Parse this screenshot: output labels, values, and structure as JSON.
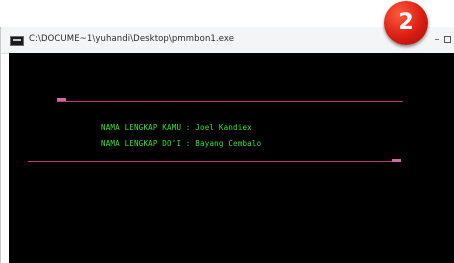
{
  "window": {
    "title": "C:\\DOCUME~1\\yuhandi\\Desktop\\pmmbon1.exe",
    "minimize_glyph": "–",
    "icon": "console-app-icon"
  },
  "console": {
    "lines": [
      "NAMA LENGKAP KAMU : Joel Kandiex",
      "NAMA LENGKAP DO'I : Bayang Cembalo"
    ],
    "text_color": "#33e13a",
    "rule_color": "#b23a78",
    "background": "#000000"
  },
  "badge": {
    "number": "2",
    "color": "#d91d12"
  }
}
